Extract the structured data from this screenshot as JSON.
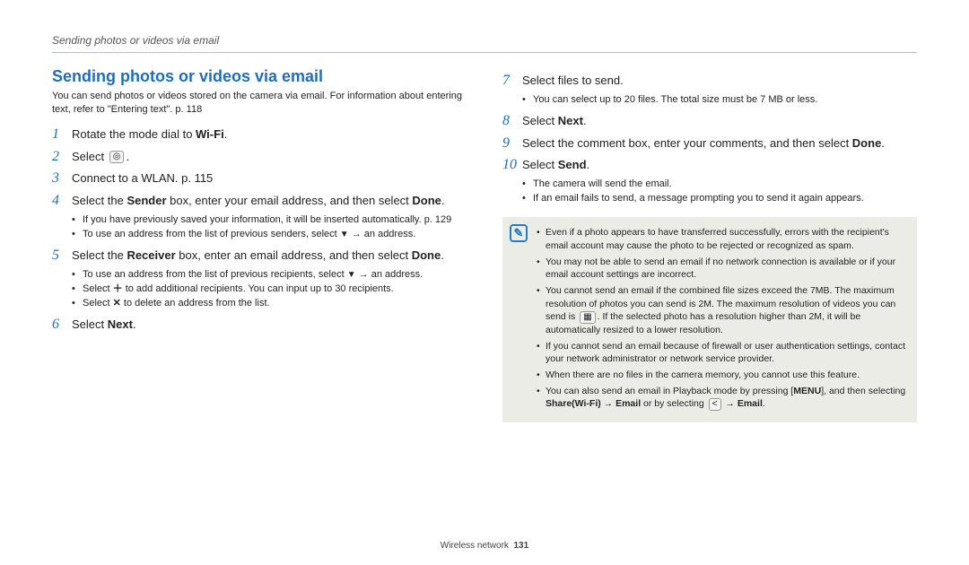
{
  "runningHeader": "Sending photos or videos via email",
  "title": "Sending photos or videos via email",
  "intro": "You can send photos or videos stored on the camera via email. For information about entering text, refer to \"Entering text\". p. 118",
  "stepsL": [
    {
      "n": "1",
      "html": "Rotate the mode dial to <span class='wifi-label'>Wi-Fi</span>."
    },
    {
      "n": "2",
      "html": "Select <span class='inline-icon' data-name='email-app-icon' data-interactable='false'>◎</span>."
    },
    {
      "n": "3",
      "html": "Connect to a WLAN. p. 115"
    },
    {
      "n": "4",
      "html": "Select the <b>Sender</b> box, enter your email address, and then select <b>Done</b>.",
      "sub": [
        "If you have previously saved your information, it will be inserted automatically. p. 129",
        "To use an address from the list of previous senders, select <span class='tri'>▼</span> → an address."
      ]
    },
    {
      "n": "5",
      "html": "Select the <b>Receiver</b> box, enter an email address, and then select <b>Done</b>.",
      "sub": [
        "To use an address from the list of previous recipients, select <span class='tri'>▼</span> → an address.",
        "Select <b>＋</b> to add additional recipients. You can input up to 30 recipients.",
        "Select <b>✕</b> to delete an address from the list."
      ]
    },
    {
      "n": "6",
      "html": "Select <b>Next</b>."
    }
  ],
  "stepsR": [
    {
      "n": "7",
      "html": "Select files to send.",
      "sub": [
        "You can select up to 20 files. The total size must be 7 MB or less."
      ]
    },
    {
      "n": "8",
      "html": "Select <b>Next</b>."
    },
    {
      "n": "9",
      "html": "Select the comment box, enter your comments, and then select <b>Done</b>."
    },
    {
      "n": "10",
      "html": "Select <b>Send</b>.",
      "sub": [
        "The camera will send the email.",
        "If an email fails to send, a message prompting you to send it again appears."
      ]
    }
  ],
  "notes": [
    "Even if a photo appears to have transferred successfully, errors with the recipient's email account may cause the photo to be rejected or recognized as spam.",
    "You may not be able to send an email if no network connection is available or if your email account settings are incorrect.",
    "You cannot send an email if the combined file sizes exceed the 7MB. The maximum resolution of photos you can send is 2M. The maximum resolution of videos you can send is <span class='inline-icon' data-name='video-res-icon' data-interactable='false'>▦</span>. If the selected photo has a resolution higher than 2M, it will be automatically resized to a lower resolution.",
    "If you cannot send an email because of firewall or user authentication settings, contact your network administrator or network service provider.",
    "When there are no files in the camera memory, you cannot use this feature.",
    "You can also send an email in Playback mode by pressing [<b>MENU</b>], and then selecting <b>Share(Wi-Fi)</b> → <b>Email</b> or by selecting <span class='inline-icon' data-name='share-icon' data-interactable='false'>&lt;</span> → <b>Email</b>."
  ],
  "footer": {
    "section": "Wireless network",
    "page": "131"
  }
}
